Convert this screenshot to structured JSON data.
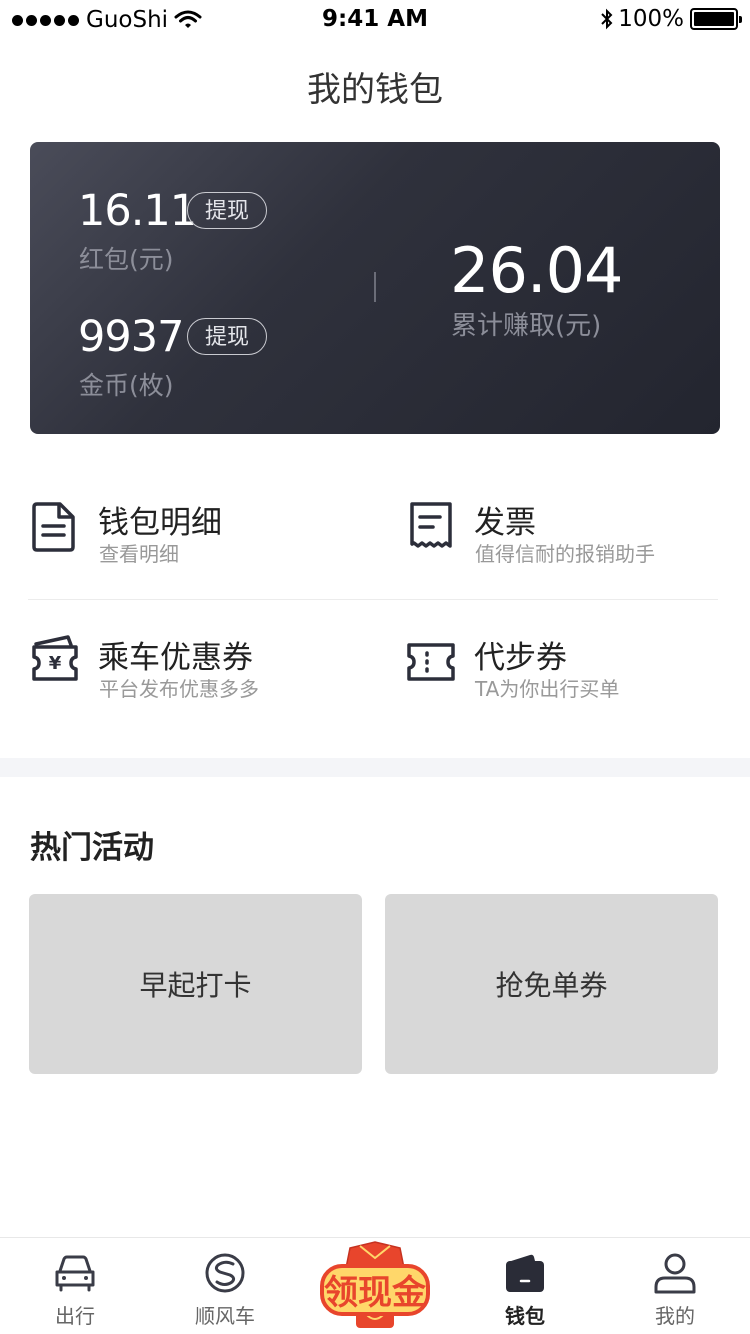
{
  "status_bar": {
    "carrier": "GuoShi",
    "time": "9:41 AM",
    "battery": "100%",
    "battery_level": 1.0
  },
  "header": {
    "title": "我的钱包"
  },
  "wallet": {
    "red_packet_amount": "16.11",
    "red_packet_label": "红包(元)",
    "coins_amount": "9937",
    "coins_label": "金币(枚)",
    "withdraw_label": "提现",
    "total_amount": "26.04",
    "total_label": "累计赚取(元)"
  },
  "services": [
    {
      "title": "钱包明细",
      "subtitle": "查看明细",
      "icon": "document-icon"
    },
    {
      "title": "发票",
      "subtitle": "值得信耐的报销助手",
      "icon": "receipt-icon"
    },
    {
      "title": "乘车优惠券",
      "subtitle": "平台发布优惠多多",
      "icon": "yuan-coupon-icon"
    },
    {
      "title": "代步券",
      "subtitle": "TA为你出行买单",
      "icon": "ticket-icon"
    }
  ],
  "activities": {
    "title": "热门活动",
    "items": [
      "早起打卡",
      "抢免单券"
    ]
  },
  "tab_bar": {
    "items": [
      {
        "label": "出行",
        "icon": "car-icon",
        "active": false
      },
      {
        "label": "顺风车",
        "icon": "ride-share-logo-icon",
        "active": false
      },
      {
        "label": "领现金",
        "icon": "cash-promo-badge-icon",
        "active": false
      },
      {
        "label": "钱包",
        "icon": "wallet-icon",
        "active": true
      },
      {
        "label": "我的",
        "icon": "user-icon",
        "active": false
      }
    ]
  },
  "colors": {
    "card_gradient_start": "#4a4c59",
    "card_gradient_end": "#23252f",
    "promo_red": "#e8452c",
    "promo_gold": "#ffd76a"
  }
}
